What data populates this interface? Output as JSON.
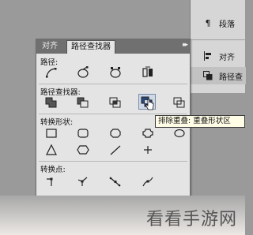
{
  "dock": {
    "items": [
      {
        "label": "段落",
        "icon": "paragraph-icon"
      },
      {
        "label": "对齐",
        "icon": "align-icon"
      },
      {
        "label": "路径查",
        "icon": "pathfinder-icon",
        "active": true
      }
    ]
  },
  "palette": {
    "tabs": [
      {
        "label": "对齐",
        "active": false
      },
      {
        "label": "路径查找器",
        "active": true
      }
    ],
    "menu_glyph": "▸▸",
    "sections": {
      "path": "路径:",
      "pathfinder": "路径查找器:",
      "convert_shape": "转换形状:",
      "convert_point": "转换点:"
    }
  },
  "tooltip": {
    "text": "排除重叠: 重叠形状区"
  },
  "watermark": {
    "text": "看看手游网"
  }
}
